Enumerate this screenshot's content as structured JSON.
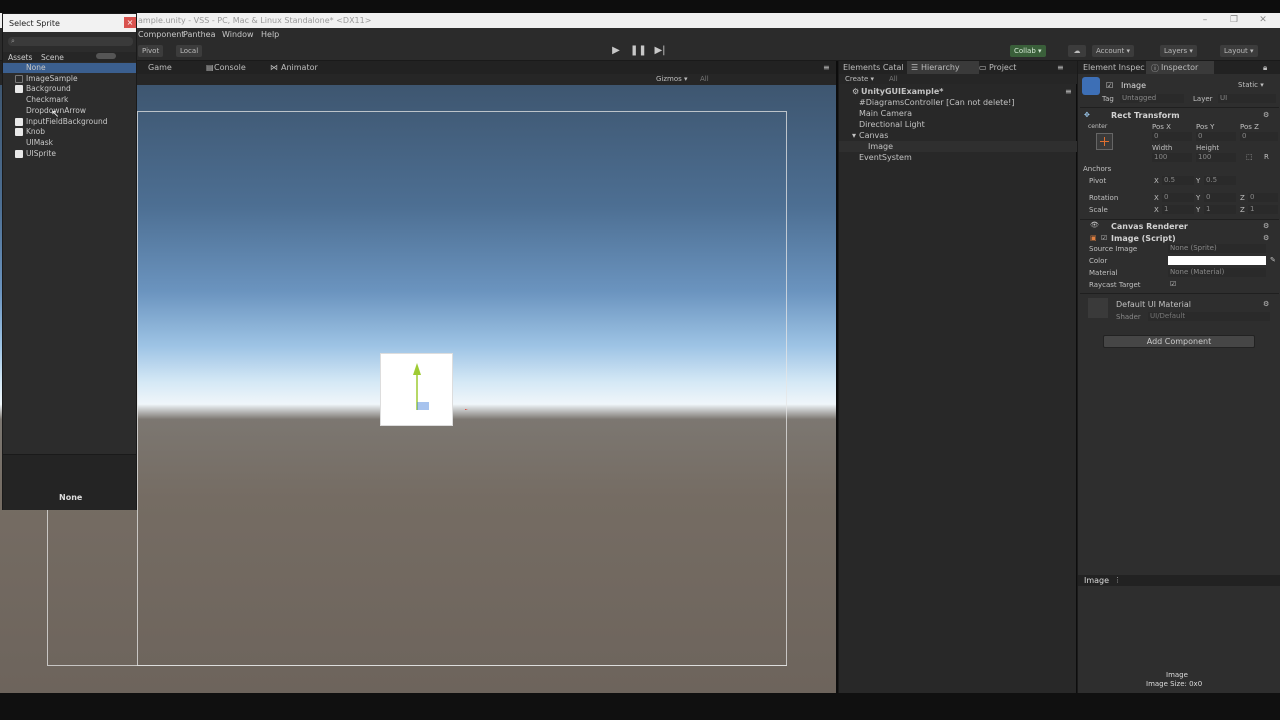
{
  "window": {
    "title": "ample.unity - VSS - PC, Mac & Linux Standalone* <DX11>",
    "minimize": "–",
    "restore": "❐",
    "close": "✕"
  },
  "menu": [
    "Component",
    "Panthea",
    "Window",
    "Help"
  ],
  "toolbar": {
    "pivot": "Pivot",
    "local": "Local",
    "collab": "Collab ▾",
    "account": "Account ▾",
    "layers": "Layers ▾",
    "layout": "Layout ▾"
  },
  "scene_tabs": {
    "game": "Game",
    "console": "Console",
    "animator": "Animator",
    "gizmos": "Gizmos ▾",
    "search": "All"
  },
  "hierarchy": {
    "tabs": [
      "Elements Catal",
      "Hierarchy",
      "Project"
    ],
    "create": "Create ▾",
    "search": "All",
    "rows": [
      {
        "label": "UnityGUIExample*",
        "indent": 0,
        "bold": true
      },
      {
        "label": "#DiagramsController [Can not delete!]",
        "indent": 1
      },
      {
        "label": "Main Camera",
        "indent": 1
      },
      {
        "label": "Directional Light",
        "indent": 1
      },
      {
        "label": "Canvas",
        "indent": 1
      },
      {
        "label": "Image",
        "indent": 2,
        "selected": true
      },
      {
        "label": "EventSystem",
        "indent": 1
      }
    ]
  },
  "inspector": {
    "tabs": [
      "Element Inspec",
      "Inspector"
    ],
    "object_name": "Image",
    "static": "Static ▾",
    "tag_label": "Tag",
    "tag_value": "Untagged",
    "layer_label": "Layer",
    "layer_value": "UI",
    "rect_transform": "Rect Transform",
    "anchor_preset": "center",
    "pos_x_label": "Pos X",
    "pos_y_label": "Pos Y",
    "pos_z_label": "Pos Z",
    "pos_x": "0",
    "pos_y": "0",
    "pos_z": "0",
    "width_label": "Width",
    "height_label": "Height",
    "width": "100",
    "height": "100",
    "anchors": "Anchors",
    "pivot_label": "Pivot",
    "pivot_x": "0.5",
    "pivot_y": "0.5",
    "rotation_label": "Rotation",
    "rot_x": "0",
    "rot_y": "0",
    "rot_z": "0",
    "scale_label": "Scale",
    "scale_x": "1",
    "scale_y": "1",
    "scale_z": "1",
    "canvas_renderer": "Canvas Renderer",
    "image_script": "Image (Script)",
    "source_image_label": "Source Image",
    "source_image": "None (Sprite)",
    "color_label": "Color",
    "material_label": "Material",
    "material": "None (Material)",
    "raycast_label": "Raycast Target",
    "default_material": "Default UI Material",
    "shader_label": "Shader",
    "shader_value": "UI/Default",
    "add_component": "Add Component",
    "preview_title": "Image",
    "preview_name": "Image",
    "preview_size": "Image Size: 0x0"
  },
  "sprite_dialog": {
    "title": "Select Sprite",
    "close": "×",
    "tabs": [
      "Assets",
      "Scene"
    ],
    "items": [
      {
        "label": "None",
        "checkbox": "none",
        "selected": true
      },
      {
        "label": "ImageSample",
        "checkbox": "empty"
      },
      {
        "label": "Background",
        "checkbox": "filled"
      },
      {
        "label": "Checkmark",
        "checkbox": "none"
      },
      {
        "label": "DropdownArrow",
        "checkbox": "none"
      },
      {
        "label": "InputFieldBackground",
        "checkbox": "filled"
      },
      {
        "label": "Knob",
        "checkbox": "filled"
      },
      {
        "label": "UIMask",
        "checkbox": "none"
      },
      {
        "label": "UISprite",
        "checkbox": "filled"
      }
    ],
    "preview_label": "None"
  },
  "colors": {
    "accent": "#3d6fb6",
    "selection": "#3b5f8f",
    "gizmo_red": "#e03b2e",
    "gizmo_green": "#9ecb33",
    "gizmo_blue": "#3b7bd9"
  }
}
